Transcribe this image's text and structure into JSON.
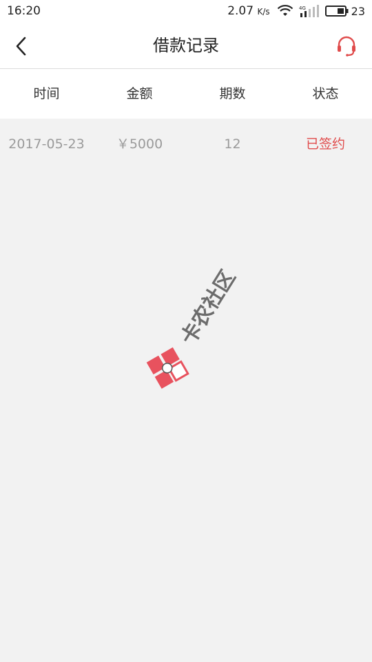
{
  "status_bar": {
    "time": "16:20",
    "net_speed": "2.07",
    "net_unit": "K/s",
    "signal_label": "4G",
    "battery": "23"
  },
  "nav": {
    "title": "借款记录",
    "back_icon": "chevron-left-icon",
    "service_icon": "headset-icon",
    "accent": "#e04b4b"
  },
  "table": {
    "headers": [
      "时间",
      "金额",
      "期数",
      "状态"
    ],
    "rows": [
      {
        "date": "2017-05-23",
        "amount": "￥5000",
        "periods": "12",
        "status": "已签约"
      }
    ]
  },
  "watermark": {
    "text": "卡农社区",
    "logo_color": "#e8525e"
  }
}
